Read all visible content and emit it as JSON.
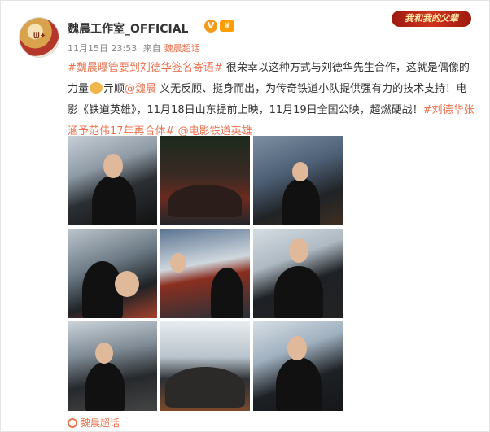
{
  "post": {
    "author": "魏晨工作室_OFFICIAL",
    "verified_badge": "V",
    "vip_badge": "♛",
    "time": "11月15日 23:53",
    "source_prefix": "来自",
    "source": "魏晨超话",
    "banner": "我和我的父辈",
    "text": {
      "tag1": "#魏晨曝管要到刘德华签名寄语#",
      "part1": " 很荣幸以这种方式与刘德华先生合作，这就是偶像的力量",
      "part2": "亓顺",
      "mention": "@魏晨",
      "part3": " 义无反顾、挺身而出，为传奇铁道小队提供强有力的技术支持！电影《铁道英雄》，11月18日山东提前上映，11月19日全国公映，超燃硬战！",
      "tag2": "#刘德华张涵予范伟17年再合体#",
      "space": " ",
      "tag3": "@电影铁道英雄"
    },
    "photos": [
      "photo-1",
      "photo-2",
      "photo-3",
      "photo-4",
      "photo-5",
      "photo-6",
      "photo-7",
      "photo-8",
      "photo-9"
    ],
    "footer_topic": "魏晨超话",
    "colors": {
      "link": "#eb7350",
      "text": "#333333",
      "meta": "#888888"
    }
  }
}
